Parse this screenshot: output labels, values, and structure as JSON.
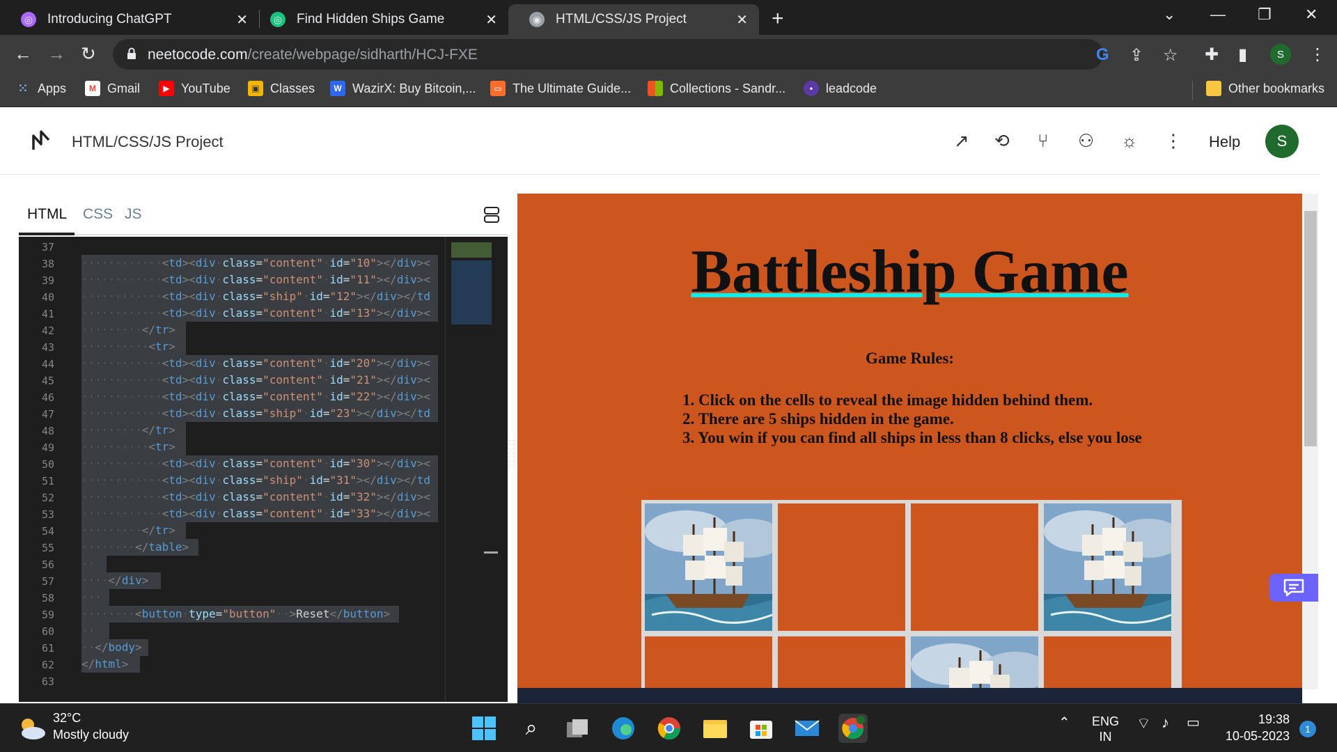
{
  "browser": {
    "tabs": [
      {
        "title": "Introducing ChatGPT"
      },
      {
        "title": "Find Hidden Ships Game"
      },
      {
        "title": "HTML/CSS/JS Project"
      }
    ],
    "url_host": "neetocode.com",
    "url_path": "/create/webpage/sidharth/HCJ-FXE",
    "profile_initial": "S",
    "bookmarks": [
      {
        "label": "Apps"
      },
      {
        "label": "Gmail"
      },
      {
        "label": "YouTube"
      },
      {
        "label": "Classes"
      },
      {
        "label": "WazirX: Buy Bitcoin,..."
      },
      {
        "label": "The Ultimate Guide..."
      },
      {
        "label": "Collections - Sandr..."
      },
      {
        "label": "leadcode"
      },
      {
        "label": "Other bookmarks"
      }
    ]
  },
  "app": {
    "title": "HTML/CSS/JS Project",
    "help_label": "Help",
    "avatar_initial": "S"
  },
  "editor": {
    "tabs": [
      "HTML",
      "CSS",
      "JS"
    ],
    "active_tab": "HTML",
    "line_numbers": [
      "37",
      "38",
      "39",
      "40",
      "41",
      "42",
      "43",
      "44",
      "45",
      "46",
      "47",
      "48",
      "49",
      "50",
      "51",
      "52",
      "53",
      "54",
      "55",
      "56",
      "57",
      "58",
      "59",
      "60",
      "61",
      "62",
      "63"
    ]
  },
  "preview": {
    "heading": "Battleship Game",
    "rules_heading": "Game Rules:",
    "rules": [
      "1. Click on the cells to reveal the image hidden behind them.",
      "2. There are 5 ships hidden in the game.",
      "3. You win if you can find all ships in less than 8 clicks, else you lose"
    ],
    "board_revealed": [
      [
        true,
        false,
        false,
        true
      ],
      [
        false,
        false,
        true,
        false
      ]
    ]
  },
  "taskbar": {
    "temperature": "32°C",
    "weather": "Mostly cloudy",
    "lang_line1": "ENG",
    "lang_line2": "IN",
    "time": "19:38",
    "date": "10-05-2023",
    "notification_count": "1"
  },
  "colors": {
    "preview_bg": "#cd561f",
    "underline": "#00f0f0",
    "editor_bg": "#1e1e1e",
    "avatar": "#1e6b2d"
  }
}
